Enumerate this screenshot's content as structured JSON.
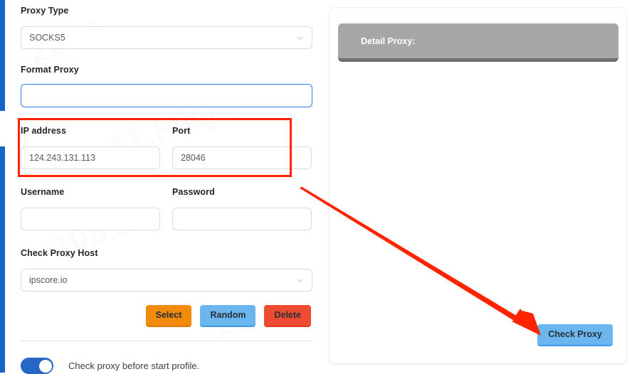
{
  "form": {
    "proxy_type": {
      "label": "Proxy Type",
      "value": "SOCKS5",
      "icon": "chevron-down-icon"
    },
    "format_proxy": {
      "label": "Format Proxy",
      "value": "",
      "placeholder": ""
    },
    "ip_address": {
      "label": "IP address",
      "value": "124.243.131.113"
    },
    "port": {
      "label": "Port",
      "value": "28046"
    },
    "username": {
      "label": "Username",
      "value": "",
      "placeholder": ""
    },
    "password": {
      "label": "Password",
      "value": "",
      "placeholder": ""
    },
    "check_proxy_host": {
      "label": "Check Proxy Host",
      "value": "ipscore.io",
      "icon": "chevron-down-icon"
    },
    "buttons": {
      "select": "Select",
      "random": "Random",
      "delete": "Delete"
    },
    "toggle": {
      "label": "Check proxy before start profile.",
      "state": "on"
    }
  },
  "detail_panel": {
    "header_text": "Detail Proxy:",
    "check_proxy_button": "Check Proxy"
  },
  "colors": {
    "rail_blue": "#1565c8",
    "accent_blue": "#2f80ed",
    "button_orange": "#f28a0c",
    "button_lightblue": "#6cb6f0",
    "button_red": "#ee4b33",
    "annotation_red": "#fe2400",
    "toggle_on": "#2766c4",
    "detail_header_grey": "#a6a6a6"
  },
  "annotations": {
    "highlight_rect": "ip-address-and-port-highlight",
    "arrow": "arrow-pointing-to-check-proxy-button"
  },
  "watermark": {
    "lines": [
      "2024",
      "11.F9Q4",
      "10812",
      "202",
      "A2"
    ]
  }
}
